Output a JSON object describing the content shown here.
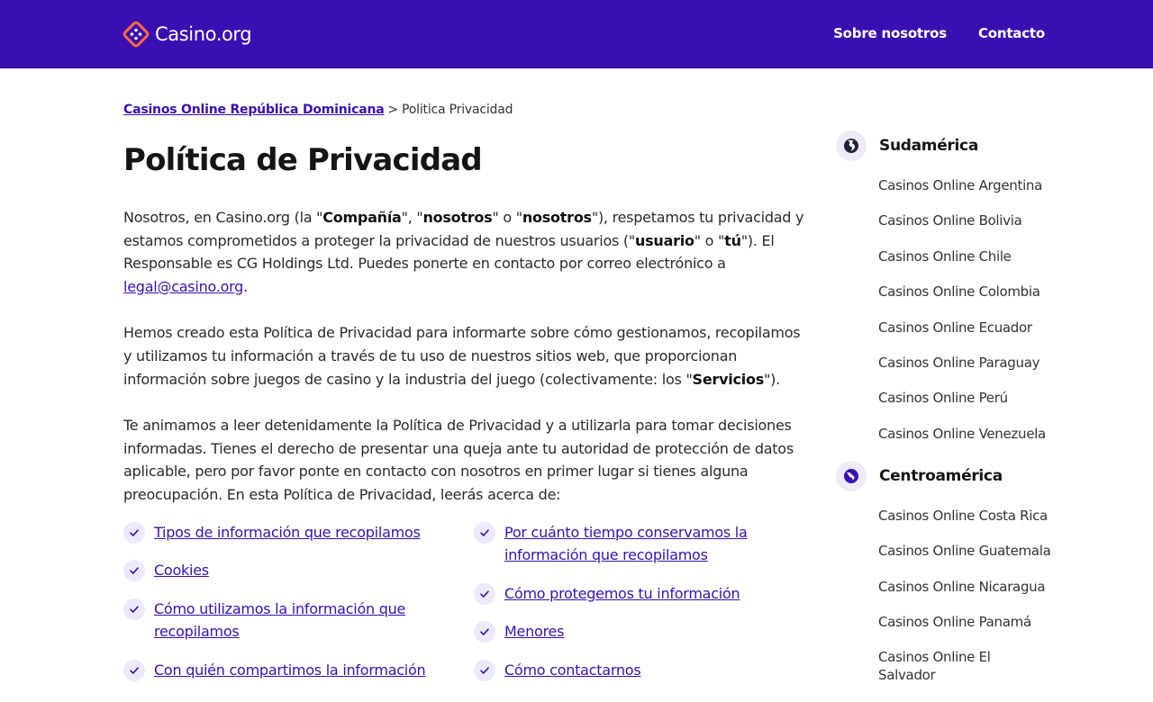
{
  "header": {
    "logo_text": "Casino.org",
    "nav": [
      {
        "label": "Sobre nosotros"
      },
      {
        "label": "Contacto"
      }
    ]
  },
  "breadcrumb": {
    "parent": "Casinos Online República Dominicana",
    "separator": ">",
    "current": "Politica Privacidad"
  },
  "page_title": "Política de Privacidad",
  "intro": {
    "p1_a": "Nosotros, en Casino.org (la \"",
    "p1_b1": "Compañía",
    "p1_c": "\", \"",
    "p1_b2": "nosotros",
    "p1_d": "\" o \"",
    "p1_b3": "nosotros",
    "p1_e": "\"), respetamos tu privacidad y estamos comprometidos a proteger la privacidad de nuestros usuarios (\"",
    "p1_b4": "usuario",
    "p1_f": "\" o \"",
    "p1_b5": "tú",
    "p1_g": "\"). El Responsable es CG Holdings Ltd. Puedes ponerte en contacto por correo electrónico a ",
    "p1_email": "legal@casino.org",
    "p1_h": ".",
    "p2_a": "Hemos creado esta Política de Privacidad para informarte sobre cómo gestionamos, recopilamos y utilizamos tu información a través de tu uso de nuestros sitios web, que proporcionan información sobre juegos de casino y la industria del juego (colectivamente: los \"",
    "p2_b": "Servicios",
    "p2_c": "\").",
    "p3": "Te animamos a leer detenidamente la Política de Privacidad y a utilizarla para tomar decisiones informadas. Tienes el derecho de presentar una queja ante tu autoridad de protección de datos aplicable, pero por favor ponte en contacto con nosotros en primer lugar si tienes alguna preocupación. En esta Política de Privacidad, leerás acerca de:"
  },
  "toc": {
    "left": [
      {
        "label": "Tipos de información que recopilamos"
      },
      {
        "label": "Cookies"
      },
      {
        "label": "Cómo utilizamos la información que recopilamos"
      },
      {
        "label": "Con quién compartimos la información"
      }
    ],
    "right": [
      {
        "label": "Por cuánto tiempo conservamos la información que recopilamos"
      },
      {
        "label": "Cómo protegemos tu información"
      },
      {
        "label": "Menores"
      },
      {
        "label": "Cómo contactarnos"
      }
    ]
  },
  "sidebar": {
    "groups": [
      {
        "title": "Sudamérica",
        "icon": "globe-americas-icon",
        "items": [
          "Casinos Online Argentina",
          "Casinos Online Bolivia",
          "Casinos Online Chile",
          "Casinos Online Colombia",
          "Casinos Online Ecuador",
          "Casinos Online Paraguay",
          "Casinos Online Perú",
          "Casinos Online Venezuela"
        ]
      },
      {
        "title": "Centroamérica",
        "icon": "globe-central-america-icon",
        "items": [
          "Casinos Online Costa Rica",
          "Casinos Online Guatemala",
          "Casinos Online Nicaragua",
          "Casinos Online Panamá",
          "Casinos Online El Salvador"
        ]
      }
    ]
  },
  "colors": {
    "brand": "#3a0fb2",
    "logo_accent": "#ff6a3d",
    "check_bg": "#ede8fb"
  }
}
